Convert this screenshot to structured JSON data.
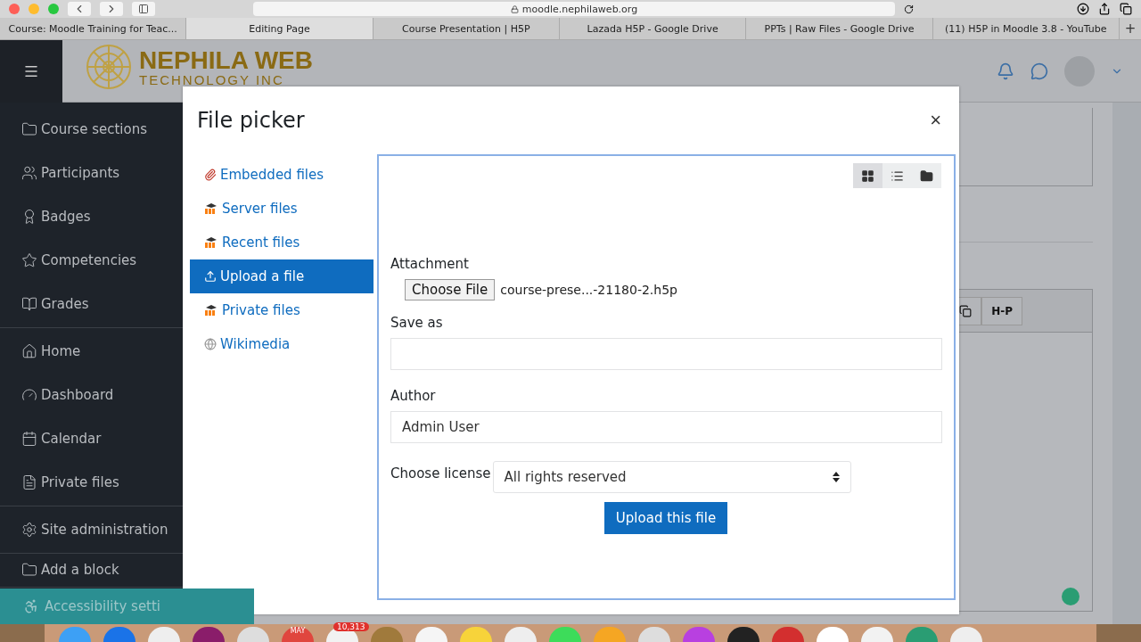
{
  "browser": {
    "url": "moodle.nephilaweb.org",
    "tabs": [
      {
        "label": "Course: Moodle Training for Teac...",
        "selected": false
      },
      {
        "label": "Editing Page",
        "selected": true
      },
      {
        "label": "Course Presentation | H5P",
        "selected": false
      },
      {
        "label": "Lazada H5P - Google Drive",
        "selected": false
      },
      {
        "label": "PPTs | Raw Files - Google Drive",
        "selected": false
      },
      {
        "label": "(11) H5P in Moodle 3.8 - YouTube",
        "selected": false
      }
    ],
    "new_tab": "+"
  },
  "logo": {
    "line1": "NEPHILA WEB",
    "line2": "TECHNOLOGY INC"
  },
  "sidebar": {
    "groups": [
      [
        {
          "label": "Course sections"
        },
        {
          "label": "Participants"
        },
        {
          "label": "Badges"
        },
        {
          "label": "Competencies"
        },
        {
          "label": "Grades"
        }
      ],
      [
        {
          "label": "Home"
        },
        {
          "label": "Dashboard"
        },
        {
          "label": "Calendar"
        },
        {
          "label": "Private files"
        }
      ],
      [
        {
          "label": "Site administration"
        }
      ],
      [
        {
          "label": "Add a block"
        }
      ]
    ],
    "accessibility": "Accessibility setti"
  },
  "editor": {
    "h5p_button": "H-P"
  },
  "dialog": {
    "title": "File picker",
    "close": "×",
    "repositories": [
      {
        "label": "Embedded files",
        "selected": false
      },
      {
        "label": "Server files",
        "selected": false
      },
      {
        "label": "Recent files",
        "selected": false
      },
      {
        "label": "Upload a file",
        "selected": true
      },
      {
        "label": "Private files",
        "selected": false
      },
      {
        "label": "Wikimedia",
        "selected": false
      }
    ],
    "views": [
      {
        "selected": true
      },
      {
        "selected": false
      },
      {
        "selected": false
      }
    ],
    "attachment_label": "Attachment",
    "choose_file": "Choose File",
    "file_name": "course-prese...-21180-2.h5p",
    "save_as_label": "Save as",
    "author_label": "Author",
    "author_value": "Admin User",
    "license_label": "Choose license",
    "license_value": "All rights reserved",
    "submit": "Upload this file"
  },
  "dock": {
    "calendar_month": "MAY",
    "mail_badge": "10,313"
  }
}
